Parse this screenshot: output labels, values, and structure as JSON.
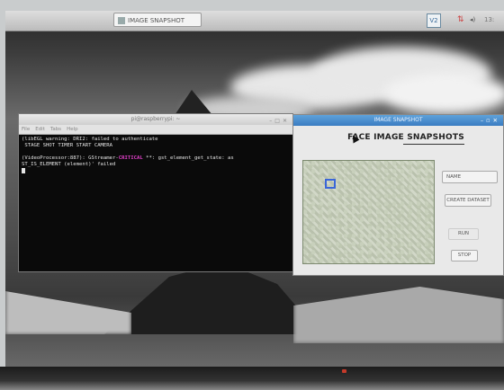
{
  "taskbar": {
    "task_label": "IMAGE SNAPSHOT",
    "tray_vnc": "V2",
    "clock": "13:"
  },
  "terminal": {
    "title": "pi@raspberrypi: ~",
    "menu": [
      "File",
      "Edit",
      "Tabs",
      "Help"
    ],
    "line1": "(libEGL warning: DRI2: failed to authenticate",
    "line2": " STAGE SHOT TIMER START CAMERA",
    "line3": "",
    "line4_prefix": "(VideoProcessor:887): GStreamer-",
    "line4_crit": "CRITICAL",
    "line4_suffix": " **: gst_element_get_state: as",
    "line5": "ST_IS_ELEMENT (element)' failed"
  },
  "app": {
    "title": "IMAGE SNAPSHOT",
    "heading": "FACE IMAGE SNAPSHOTS",
    "name_field": "NAME",
    "create_button": "CREATE DATASET",
    "run_button": "RUN",
    "stop_button": "STOP"
  },
  "colors": {
    "titlebar_accent": "#3a7cc2",
    "critical_text": "#e040c8",
    "face_box": "#3a66d8"
  }
}
